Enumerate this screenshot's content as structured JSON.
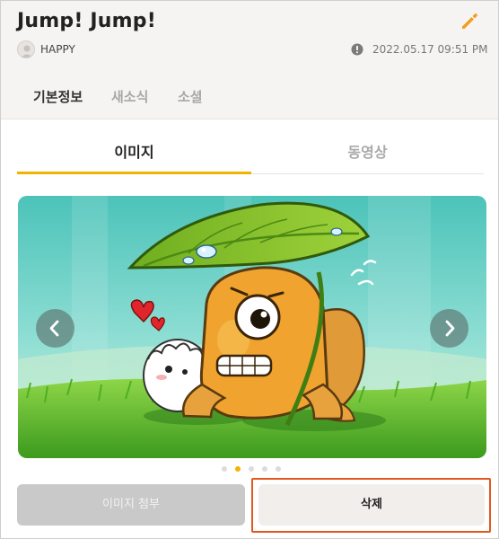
{
  "header": {
    "title": "Jump! Jump!",
    "author": "HAPPY",
    "datetime": "2022.05.17 09:51 PM"
  },
  "subtabs": [
    "기본정보",
    "새소식",
    "소셜"
  ],
  "media_tabs": [
    "이미지",
    "동영상"
  ],
  "carousel": {
    "slide_count": 5,
    "active_index": 1
  },
  "buttons": {
    "attach": "이미지 첨부",
    "delete": "삭제"
  },
  "colors": {
    "accent": "#f0b400",
    "highlight_border": "#e4571e",
    "header_bg": "#f6f4f2"
  },
  "icons": [
    "pencil-icon",
    "alert-circle-icon",
    "chevron-left-icon",
    "chevron-right-icon"
  ]
}
